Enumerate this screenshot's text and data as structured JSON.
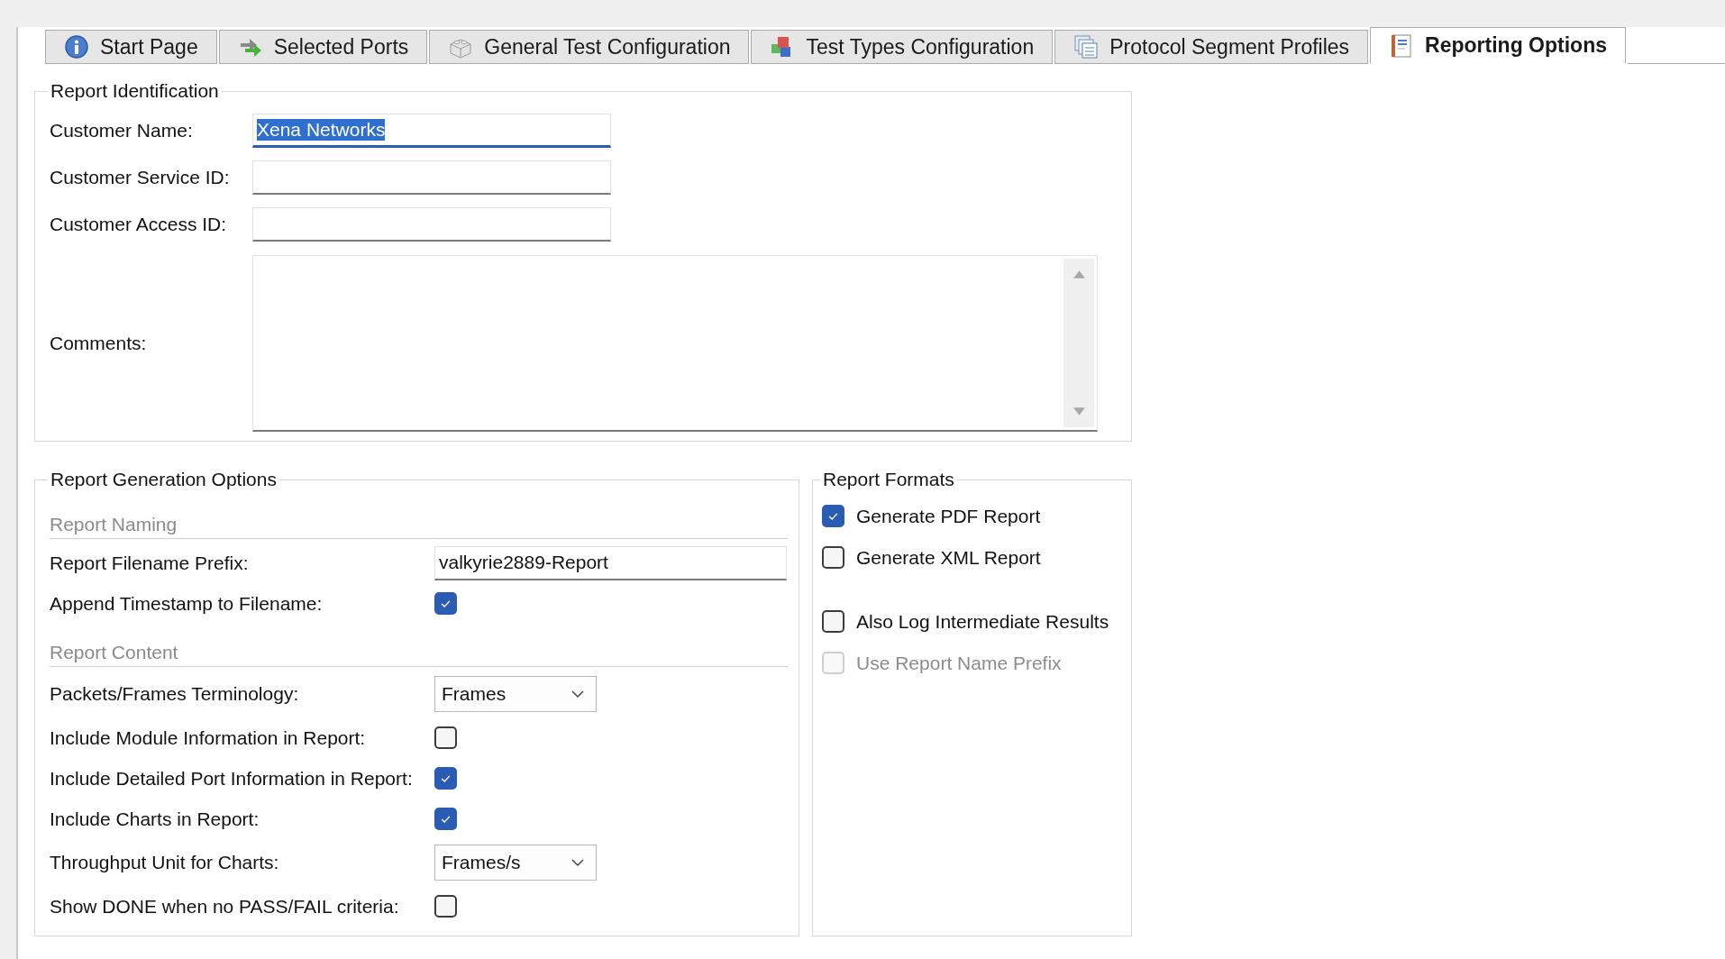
{
  "tabs": [
    {
      "label": "Start Page",
      "selected": false
    },
    {
      "label": "Selected Ports",
      "selected": false
    },
    {
      "label": "General Test Configuration",
      "selected": false
    },
    {
      "label": "Test Types Configuration",
      "selected": false
    },
    {
      "label": "Protocol Segment Profiles",
      "selected": false
    },
    {
      "label": "Reporting Options",
      "selected": true
    }
  ],
  "report_identification": {
    "title": "Report Identification",
    "fields": [
      {
        "label": "Customer Name:",
        "value": "Xena Networks",
        "focused": true
      },
      {
        "label": "Customer Service ID:",
        "focused": false
      },
      {
        "label": "Customer Access ID:",
        "focused": false
      }
    ],
    "comments": {
      "label": "Comments:"
    }
  },
  "report_generation_options": {
    "title": "Report Generation Options",
    "sections": [
      {
        "heading": "Report Naming",
        "rows": [
          {
            "kind": "text",
            "label": "Report Filename Prefix:",
            "value": "valkyrie2889-Report"
          },
          {
            "kind": "checkbox",
            "label": "Append Timestamp to Filename:",
            "checked": true
          }
        ]
      },
      {
        "heading": "Report Content",
        "rows": [
          {
            "kind": "dropdown",
            "label": "Packets/Frames Terminology:",
            "value": "Frames"
          },
          {
            "kind": "checkbox",
            "label": "Include Module Information in Report:",
            "checked": false
          },
          {
            "kind": "checkbox",
            "label": "Include Detailed Port Information in Report:",
            "checked": true
          },
          {
            "kind": "checkbox",
            "label": "Include Charts in Report:",
            "checked": true
          },
          {
            "kind": "dropdown",
            "label": "Throughput Unit for Charts:",
            "value": "Frames/s"
          },
          {
            "kind": "checkbox",
            "label": "Show DONE when no PASS/FAIL criteria:",
            "checked": false
          }
        ]
      }
    ]
  },
  "report_formats": {
    "title": "Report Formats",
    "formats": [
      {
        "label": "Generate PDF Report",
        "checked": true,
        "disabled": false
      },
      {
        "label": "Generate XML Report",
        "checked": false,
        "disabled": false
      }
    ],
    "logging": [
      {
        "label": "Also Log Intermediate Results",
        "checked": false,
        "disabled": false
      },
      {
        "label": "Use Report Name Prefix",
        "checked": false,
        "disabled": true
      }
    ]
  }
}
